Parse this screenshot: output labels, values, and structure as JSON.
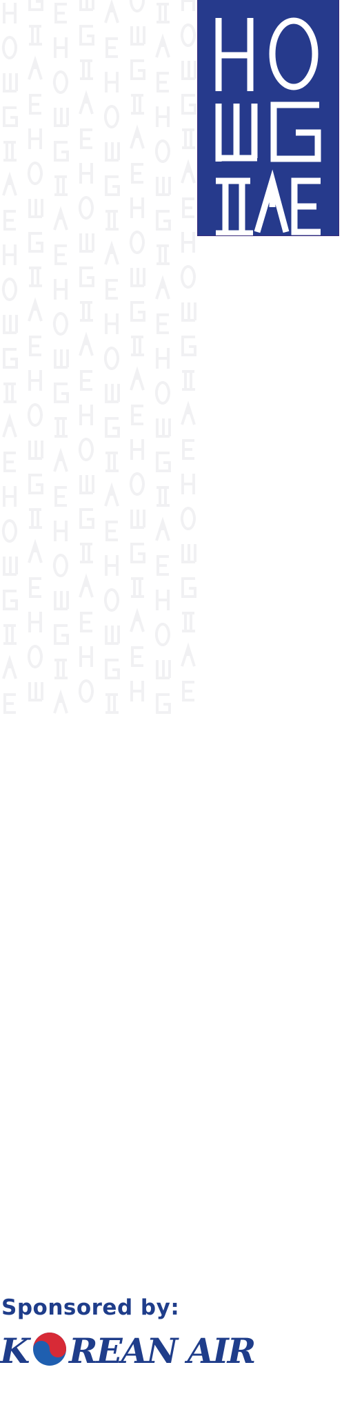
{
  "banner": {
    "logo_text": "HONGDAE",
    "color": "#263a8c"
  },
  "pattern": {
    "color": "#f1f1f3",
    "glyphs": [
      "H",
      "O",
      "N",
      "G",
      "D",
      "A",
      "E"
    ]
  },
  "sponsor": {
    "label": "Sponsored by:",
    "logo_text": "KOREAN AIR",
    "text_color": "#1f3d8a",
    "emblem_colors": [
      "#d72a36",
      "#1f5fb0"
    ]
  }
}
